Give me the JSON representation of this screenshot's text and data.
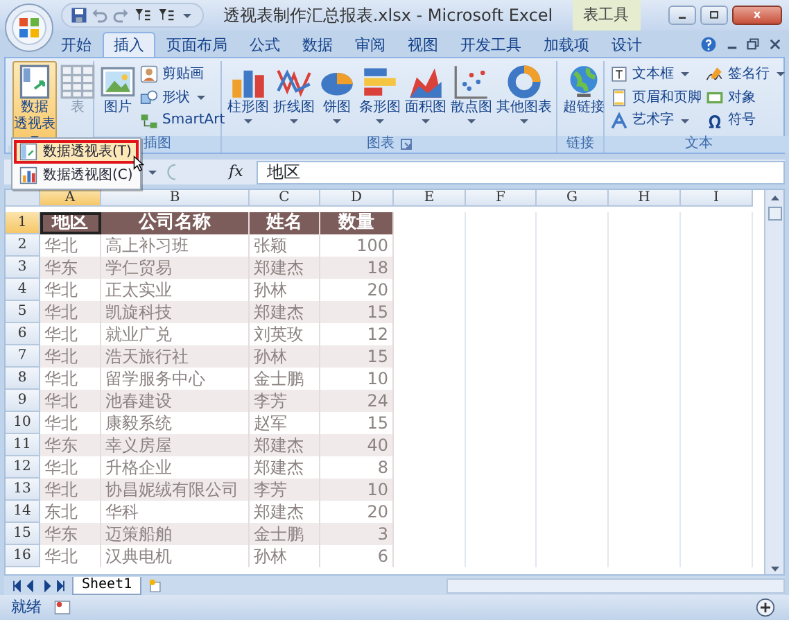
{
  "window": {
    "title": "透视表制作汇总报表.xlsx - Microsoft Excel",
    "context_tab": "表工具"
  },
  "tabs": [
    {
      "label": "开始",
      "selected": false
    },
    {
      "label": "插入",
      "selected": true
    },
    {
      "label": "页面布局",
      "selected": false
    },
    {
      "label": "公式",
      "selected": false
    },
    {
      "label": "数据",
      "selected": false
    },
    {
      "label": "审阅",
      "selected": false
    },
    {
      "label": "视图",
      "selected": false
    },
    {
      "label": "开发工具",
      "selected": false
    },
    {
      "label": "加载项",
      "selected": false
    },
    {
      "label": "设计",
      "selected": false
    }
  ],
  "ribbon": {
    "groups": [
      {
        "buttons": [
          {
            "label_lines": [
              "数据",
              "透视表"
            ],
            "kind": "large",
            "menu": true,
            "open": true
          },
          {
            "label": "表",
            "kind": "large",
            "disabled": true
          }
        ]
      },
      {
        "label": "插图",
        "buttons": [
          {
            "label": "图片",
            "kind": "large"
          },
          {
            "label": "剪贴画",
            "kind": "small"
          },
          {
            "label": "形状",
            "kind": "small",
            "menu": true
          },
          {
            "label": "SmartArt",
            "kind": "small"
          }
        ]
      },
      {
        "label": "图表",
        "launcher": true,
        "buttons": [
          {
            "label": "柱形图",
            "kind": "large",
            "menu": true
          },
          {
            "label": "折线图",
            "kind": "large",
            "menu": true
          },
          {
            "label": "饼图",
            "kind": "large",
            "menu": true
          },
          {
            "label": "条形图",
            "kind": "large",
            "menu": true
          },
          {
            "label": "面积图",
            "kind": "large",
            "menu": true
          },
          {
            "label": "散点图",
            "kind": "large",
            "menu": true
          },
          {
            "label": "其他图表",
            "kind": "large",
            "menu": true
          }
        ]
      },
      {
        "label": "链接",
        "buttons": [
          {
            "label": "超链接",
            "kind": "large"
          }
        ]
      },
      {
        "label": "文本",
        "buttons": [
          {
            "label": "文本框",
            "kind": "small",
            "menu": true
          },
          {
            "label": "页眉和页脚",
            "kind": "small"
          },
          {
            "label": "艺术字",
            "kind": "small",
            "menu": true
          },
          {
            "label": "签名行",
            "kind": "small",
            "menu": true
          },
          {
            "label": "对象",
            "kind": "small"
          },
          {
            "label": "符号",
            "kind": "small"
          }
        ]
      }
    ]
  },
  "menu": {
    "items": [
      {
        "label": "数据透视表(T)",
        "selected": true
      },
      {
        "label": "数据透视图(C)",
        "selected": false
      }
    ]
  },
  "formula_bar": {
    "fx": "fx",
    "value": "地区"
  },
  "sheet": {
    "columns": [
      {
        "label": "A",
        "selected": true
      },
      {
        "label": "B",
        "selected": false
      },
      {
        "label": "C",
        "selected": false
      },
      {
        "label": "D",
        "selected": false
      },
      {
        "label": "E",
        "selected": false
      },
      {
        "label": "F",
        "selected": false
      },
      {
        "label": "G",
        "selected": false
      },
      {
        "label": "H",
        "selected": false
      },
      {
        "label": "I",
        "selected": false
      }
    ],
    "rows": [
      {
        "number": "1",
        "selected": true,
        "kind": "header",
        "cells": [
          "地区",
          "公司名称",
          "姓名",
          "数量"
        ]
      },
      {
        "number": "2",
        "selected": false,
        "kind": "data",
        "cells": [
          "华北",
          "高上补习班",
          "张颖",
          "100"
        ]
      },
      {
        "number": "3",
        "selected": false,
        "kind": "data",
        "cells": [
          "华东",
          "学仁贸易",
          "郑建杰",
          "18"
        ]
      },
      {
        "number": "4",
        "selected": false,
        "kind": "data",
        "cells": [
          "华北",
          "正太实业",
          "孙林",
          "20"
        ]
      },
      {
        "number": "5",
        "selected": false,
        "kind": "data",
        "cells": [
          "华北",
          "凯旋科技",
          "郑建杰",
          "15"
        ]
      },
      {
        "number": "6",
        "selected": false,
        "kind": "data",
        "cells": [
          "华北",
          "就业广兑",
          "刘英玫",
          "12"
        ]
      },
      {
        "number": "7",
        "selected": false,
        "kind": "data",
        "cells": [
          "华北",
          "浩天旅行社",
          "孙林",
          "15"
        ]
      },
      {
        "number": "8",
        "selected": false,
        "kind": "data",
        "cells": [
          "华北",
          "留学服务中心",
          "金士鹏",
          "10"
        ]
      },
      {
        "number": "9",
        "selected": false,
        "kind": "data",
        "cells": [
          "华北",
          "池春建设",
          "李芳",
          "24"
        ]
      },
      {
        "number": "10",
        "selected": false,
        "kind": "data",
        "cells": [
          "华北",
          "康毅系统",
          "赵军",
          "15"
        ]
      },
      {
        "number": "11",
        "selected": false,
        "kind": "data",
        "cells": [
          "华东",
          "幸义房屋",
          "郑建杰",
          "40"
        ]
      },
      {
        "number": "12",
        "selected": false,
        "kind": "data",
        "cells": [
          "华北",
          "升格企业",
          "郑建杰",
          "8"
        ]
      },
      {
        "number": "13",
        "selected": false,
        "kind": "data",
        "cells": [
          "华北",
          "协昌妮绒有限公司",
          "李芳",
          "10"
        ]
      },
      {
        "number": "14",
        "selected": false,
        "kind": "data",
        "cells": [
          "东北",
          "华科",
          "郑建杰",
          "20"
        ]
      },
      {
        "number": "15",
        "selected": false,
        "kind": "data",
        "cells": [
          "华东",
          "迈策船舶",
          "金士鹏",
          "3"
        ]
      },
      {
        "number": "16",
        "selected": false,
        "kind": "data",
        "cells": [
          "华北",
          "汉典电机",
          "孙林",
          "6"
        ]
      }
    ]
  },
  "sheet_tabs": [
    {
      "label": "Sheet1",
      "selected": true
    }
  ],
  "status_bar": {
    "text": "就绪"
  }
}
